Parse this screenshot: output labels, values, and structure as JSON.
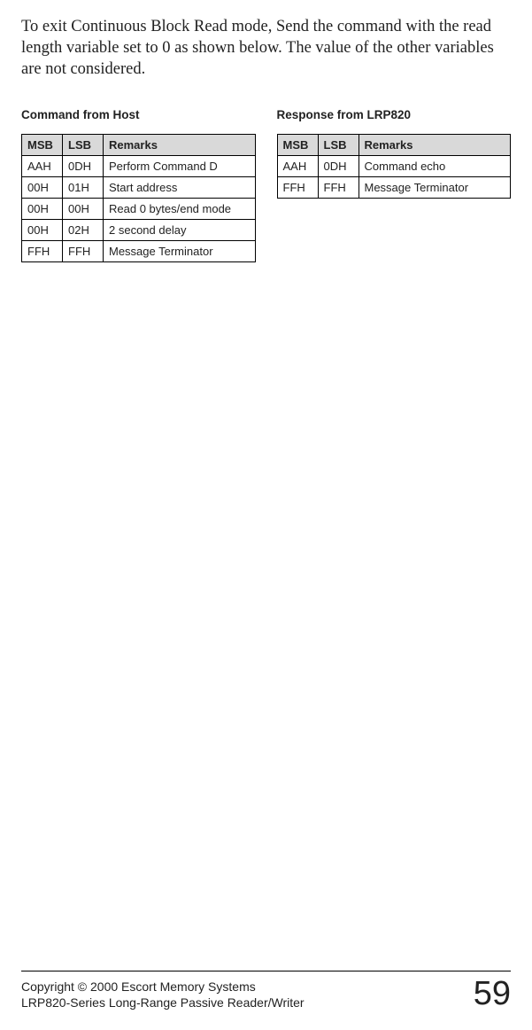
{
  "intro": "To exit Continuous Block Read mode, Send the command with the read length variable set to 0 as shown below. The value of the other variables are not considered.",
  "tables": {
    "left": {
      "title": "Command from Host",
      "headers": {
        "msb": "MSB",
        "lsb": "LSB",
        "remarks": "Remarks"
      },
      "rows": [
        {
          "msb": "AAH",
          "lsb": "0DH",
          "remarks": "Perform Command D"
        },
        {
          "msb": "00H",
          "lsb": "01H",
          "remarks": "Start address"
        },
        {
          "msb": "00H",
          "lsb": "00H",
          "remarks": "Read 0 bytes/end mode"
        },
        {
          "msb": "00H",
          "lsb": "02H",
          "remarks": "2 second delay"
        },
        {
          "msb": "FFH",
          "lsb": "FFH",
          "remarks": "Message Terminator"
        }
      ]
    },
    "right": {
      "title": "Response from LRP820",
      "headers": {
        "msb": "MSB",
        "lsb": "LSB",
        "remarks": "Remarks"
      },
      "rows": [
        {
          "msb": "AAH",
          "lsb": "0DH",
          "remarks": "Command echo"
        },
        {
          "msb": "FFH",
          "lsb": "FFH",
          "remarks": "Message Terminator"
        }
      ]
    }
  },
  "footer": {
    "line1": "Copyright © 2000 Escort Memory Systems",
    "line2": "LRP820-Series Long-Range Passive Reader/Writer",
    "page": "59"
  }
}
